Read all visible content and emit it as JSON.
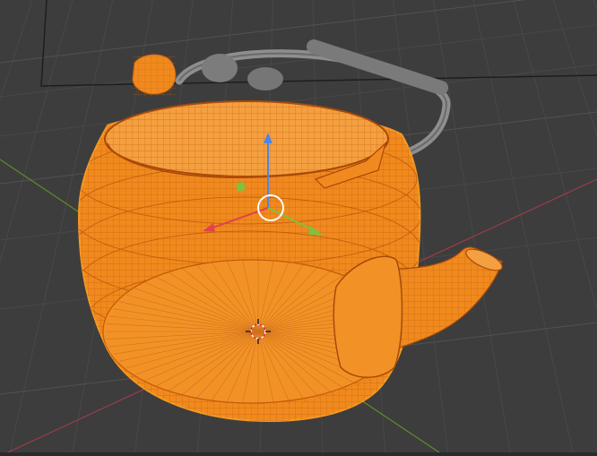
{
  "viewport": {
    "background": "#3d3d3d",
    "grid_color": "#484848",
    "grid_major_color": "#525252"
  },
  "axes": {
    "x_axis_color": "#9c3c48",
    "y_axis_color": "#5f8a2e"
  },
  "selection": {
    "outline_color": "#f59a23",
    "wire_color": "#f2922a",
    "fill_color": "#f08a1e",
    "unselected_mesh_color": "#8a8a8a"
  },
  "gizmo": {
    "x_arrow_color": "#e0424f",
    "y_arrow_color": "#7ec23d",
    "z_arrow_color": "#4a86e8",
    "center_ring_color": "#ffffff"
  },
  "cursor_3d": {
    "icon": "3d-cursor-icon"
  }
}
